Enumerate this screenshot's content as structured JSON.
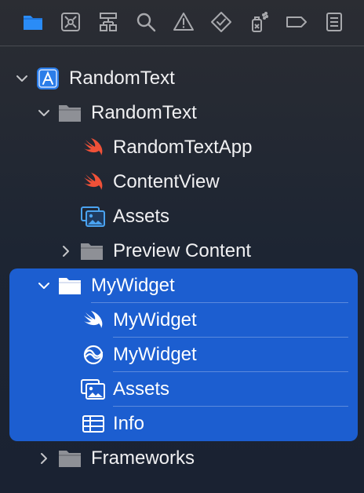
{
  "toolbar": {
    "items": [
      {
        "icon": "folder-icon",
        "active": true
      },
      {
        "icon": "source-control-icon"
      },
      {
        "icon": "hierarchy-icon"
      },
      {
        "icon": "search-icon"
      },
      {
        "icon": "warning-icon"
      },
      {
        "icon": "test-diamond-icon"
      },
      {
        "icon": "debug-spray-icon"
      },
      {
        "icon": "breakpoint-tag-icon"
      },
      {
        "icon": "report-list-icon"
      }
    ]
  },
  "colors": {
    "accent": "#1c5ed0",
    "folder_active": "#2a8cf7",
    "swift_orange": "#f05138",
    "asset_blue": "#4aa3f0"
  },
  "tree": {
    "project": {
      "label": "RandomText",
      "icon": "xcode-project-icon",
      "expanded": true
    },
    "group_random_text": {
      "label": "RandomText",
      "icon": "folder-icon",
      "expanded": true
    },
    "file_random_text_app": {
      "label": "RandomTextApp",
      "icon": "swift-file-icon"
    },
    "file_content_view": {
      "label": "ContentView",
      "icon": "swift-file-icon"
    },
    "assets_1": {
      "label": "Assets",
      "icon": "asset-catalog-icon"
    },
    "group_preview_content": {
      "label": "Preview Content",
      "icon": "folder-icon",
      "expanded": false
    },
    "group_my_widget": {
      "label": "MyWidget",
      "icon": "folder-icon",
      "expanded": true,
      "selected": true
    },
    "file_my_widget_swift": {
      "label": "MyWidget",
      "icon": "swift-file-icon"
    },
    "file_my_widget_intent": {
      "label": "MyWidget",
      "icon": "intent-definition-icon"
    },
    "assets_2": {
      "label": "Assets",
      "icon": "asset-catalog-icon"
    },
    "info_plist": {
      "label": "Info",
      "icon": "plist-table-icon"
    },
    "group_frameworks": {
      "label": "Frameworks",
      "icon": "folder-icon",
      "expanded": false
    }
  }
}
